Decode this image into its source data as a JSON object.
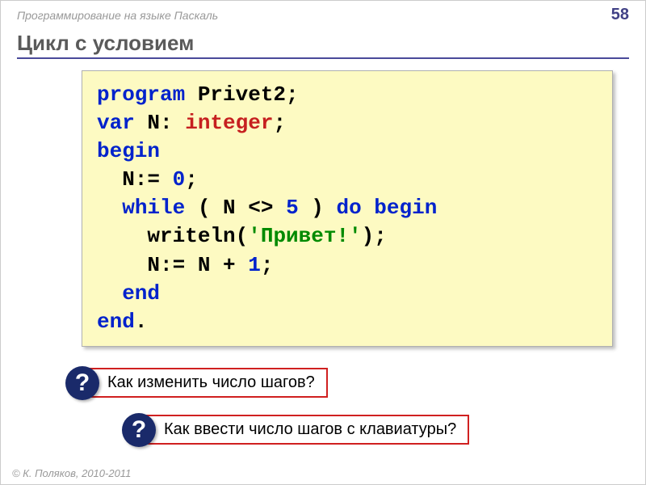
{
  "header": {
    "title": "Программирование на языке Паскаль",
    "page_number": "58"
  },
  "slide_title": "Цикл с условием",
  "code": {
    "t_program": "program",
    "progname": " Privet2;",
    "t_var": "var",
    "var_n": " N: ",
    "t_integer": "integer",
    "semi": ";",
    "t_begin": "begin",
    "line_assign_pre": "  N:= ",
    "zero": "0",
    "while_pre": "  ",
    "t_while": "while",
    "while_cond": " ( N <> ",
    "five": "5",
    "while_cond2": " ) ",
    "t_do_begin": "do begin",
    "writeln_pre": "    writeln(",
    "str_privet": "'Привет!'",
    "writeln_post": ");",
    "nplus_pre": "    N:= N + ",
    "one": "1",
    "end_inner": "  end",
    "end_outer": "end",
    "dot": "."
  },
  "questions": {
    "q_mark": "?",
    "q1": "Как изменить число шагов?",
    "q2": "Как ввести число шагов с клавиатуры?"
  },
  "footer": "© К. Поляков, 2010-2011"
}
